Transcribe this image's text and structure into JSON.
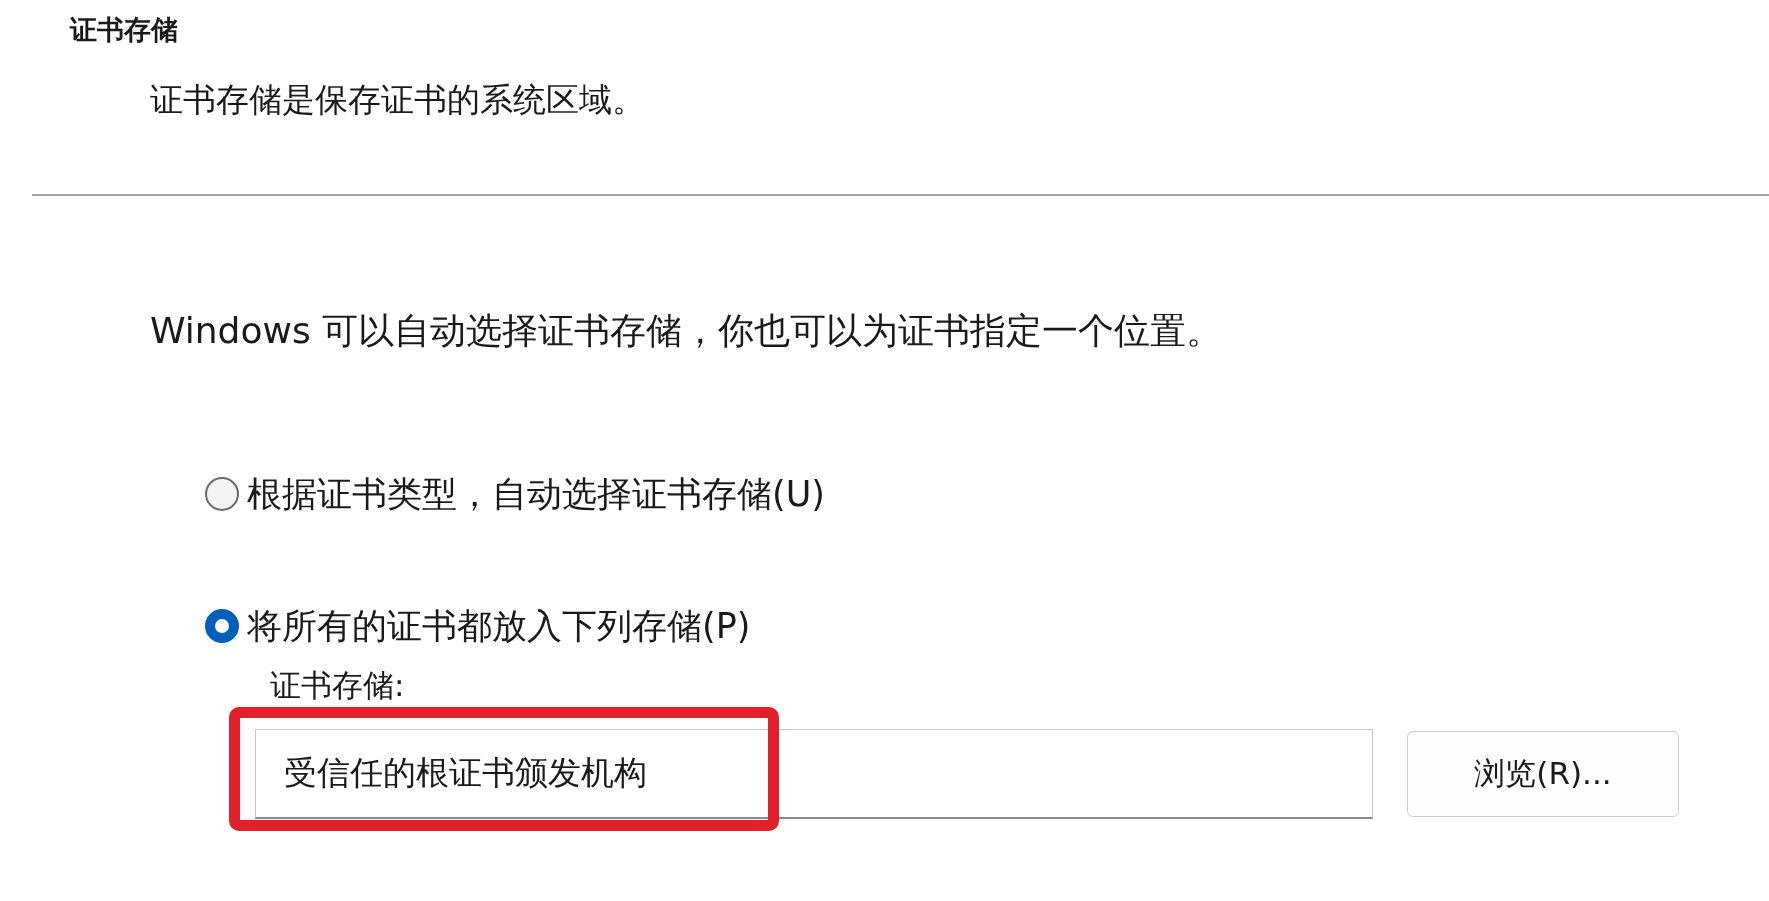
{
  "section": {
    "title": "证书存储",
    "description": "证书存储是保存证书的系统区域。"
  },
  "intro": "Windows 可以自动选择证书存储，你也可以为证书指定一个位置。",
  "options": [
    {
      "label": "根据证书类型，自动选择证书存储(U)",
      "selected": false
    },
    {
      "label": "将所有的证书都放入下列存储(P)",
      "selected": true
    }
  ],
  "store_field": {
    "label": "证书存储:",
    "value": "受信任的根证书颁发机构",
    "highlighted": true
  },
  "browse_button": "浏览(R)..."
}
